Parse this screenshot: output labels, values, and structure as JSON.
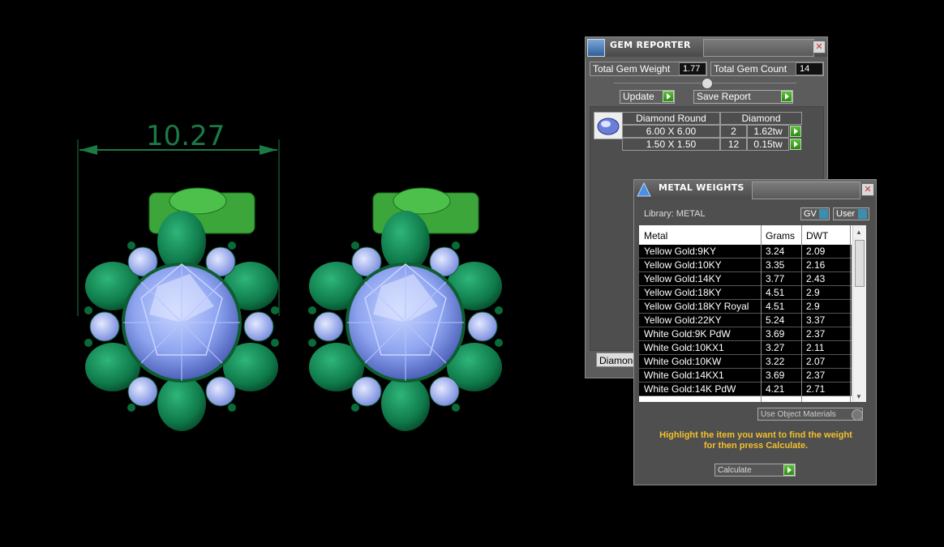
{
  "viewport": {
    "dimension": "10.27"
  },
  "gem_reporter": {
    "title": "GEM REPORTER",
    "total_weight_label": "Total Gem Weight",
    "total_weight_value": "1.77",
    "total_count_label": "Total Gem Count",
    "total_count_value": "14",
    "update_label": "Update",
    "save_label": "Save Report",
    "table": {
      "col1_header": "Diamond Round",
      "col2_header": "Diamond",
      "rows": [
        {
          "size": "6.00 X 6.00",
          "count": "2",
          "weight": "1.62tw"
        },
        {
          "size": "1.50 X 1.50",
          "count": "12",
          "weight": "0.15tw"
        }
      ]
    },
    "bottom_tab": "Diamond"
  },
  "metal_weights": {
    "title": "METAL WEIGHTS",
    "library_label": "Library: METAL",
    "gv_label": "GV",
    "user_label": "User",
    "columns": [
      "Metal",
      "Grams",
      "DWT"
    ],
    "rows": [
      {
        "metal": "Yellow Gold:9KY",
        "grams": "3.24",
        "dwt": "2.09"
      },
      {
        "metal": "Yellow Gold:10KY",
        "grams": "3.35",
        "dwt": "2.16"
      },
      {
        "metal": "Yellow Gold:14KY",
        "grams": "3.77",
        "dwt": "2.43"
      },
      {
        "metal": "Yellow Gold:18KY",
        "grams": "4.51",
        "dwt": "2.9"
      },
      {
        "metal": "Yellow Gold:18KY Royal",
        "grams": "4.51",
        "dwt": "2.9"
      },
      {
        "metal": "Yellow Gold:22KY",
        "grams": "5.24",
        "dwt": "3.37"
      },
      {
        "metal": "White Gold:9K PdW",
        "grams": "3.69",
        "dwt": "2.37"
      },
      {
        "metal": "White Gold:10KX1",
        "grams": "3.27",
        "dwt": "2.11"
      },
      {
        "metal": "White Gold:10KW",
        "grams": "3.22",
        "dwt": "2.07"
      },
      {
        "metal": "White Gold:14KX1",
        "grams": "3.69",
        "dwt": "2.37"
      },
      {
        "metal": "White Gold:14K PdW",
        "grams": "4.21",
        "dwt": "2.71"
      }
    ],
    "use_object_label": "Use Object Materials",
    "hint_line1": "Highlight the item you want to find the weight",
    "hint_line2": "for then press Calculate.",
    "calculate_label": "Calculate"
  }
}
